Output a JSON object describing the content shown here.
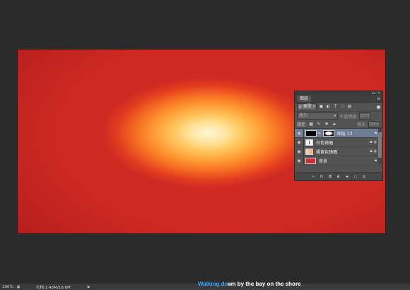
{
  "layers_panel": {
    "tab_label": "图层",
    "collapse_glyph": "◂◂",
    "close_glyph": "✕",
    "menu_icon": "panel-menu-icon",
    "filter": {
      "kind_label": "类型",
      "chevron": "▾"
    },
    "blend": {
      "mode": "叠加",
      "opacity_label": "不透明度:",
      "opacity_value": "100%",
      "fill_label": "填充:",
      "fill_value": "100%"
    },
    "lock_label": "锁定:",
    "layers": [
      {
        "name": "图层 13",
        "selected": true,
        "visible": true
      },
      {
        "name": "白色镜幅",
        "selected": false,
        "visible": true
      },
      {
        "name": "橘黄色镜幅",
        "selected": false,
        "visible": true
      },
      {
        "name": "背景",
        "selected": false,
        "visible": true
      }
    ]
  },
  "status_bar": {
    "zoom": "100%",
    "doc_info": "文档:1.43M/18.6M",
    "arrow": "▶"
  },
  "lyrics": {
    "highlighted": "Walking do",
    "rest": "wn by the bay on the shore"
  },
  "colors": {
    "workspace": "#2b2b2b",
    "panel": "#535353",
    "selected_layer": "#6d7c92",
    "lyrics_highlight": "#2fa7ff"
  }
}
